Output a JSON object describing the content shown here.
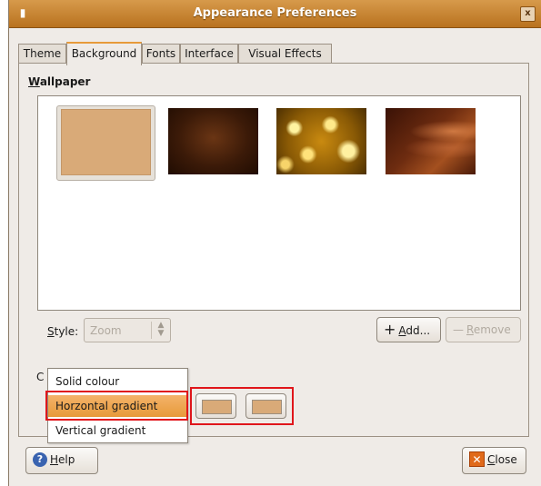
{
  "window": {
    "title": "Appearance Preferences",
    "close_glyph": "x"
  },
  "tabs": [
    {
      "label": "Theme"
    },
    {
      "label": "Background"
    },
    {
      "label": "Fonts"
    },
    {
      "label": "Interface"
    },
    {
      "label": "Visual Effects"
    }
  ],
  "active_tab": "Background",
  "wallpaper": {
    "label_first": "W",
    "label_rest": "allpaper",
    "items": [
      {
        "name": "solid-tan",
        "selected": true,
        "color": "#d9aa78"
      },
      {
        "name": "dark-brown-texture",
        "selected": false
      },
      {
        "name": "golden-spheres",
        "selected": false
      },
      {
        "name": "brown-swirl",
        "selected": false
      }
    ]
  },
  "style": {
    "label_first": "S",
    "label_rest": "tyle:",
    "value": "Zoom"
  },
  "buttons": {
    "add": {
      "icon": "+",
      "label_first": "A",
      "label_rest": "dd..."
    },
    "remove": {
      "icon": "—",
      "label_first": "R",
      "label_rest": "emove"
    },
    "help": {
      "label_first": "H",
      "label_rest": "elp"
    },
    "close": {
      "label_first": "C",
      "label_rest": "lose"
    }
  },
  "colours": {
    "label_visible": "C",
    "options": [
      "Solid colour",
      "Horzontal gradient",
      "Vertical gradient"
    ],
    "selected": "Horzontal gradient",
    "primary_color": "#d9aa78",
    "secondary_color": "#d9aa78"
  },
  "accent": {
    "highlight_color": "#e79a3a",
    "annotation_color": "#e0161b"
  }
}
